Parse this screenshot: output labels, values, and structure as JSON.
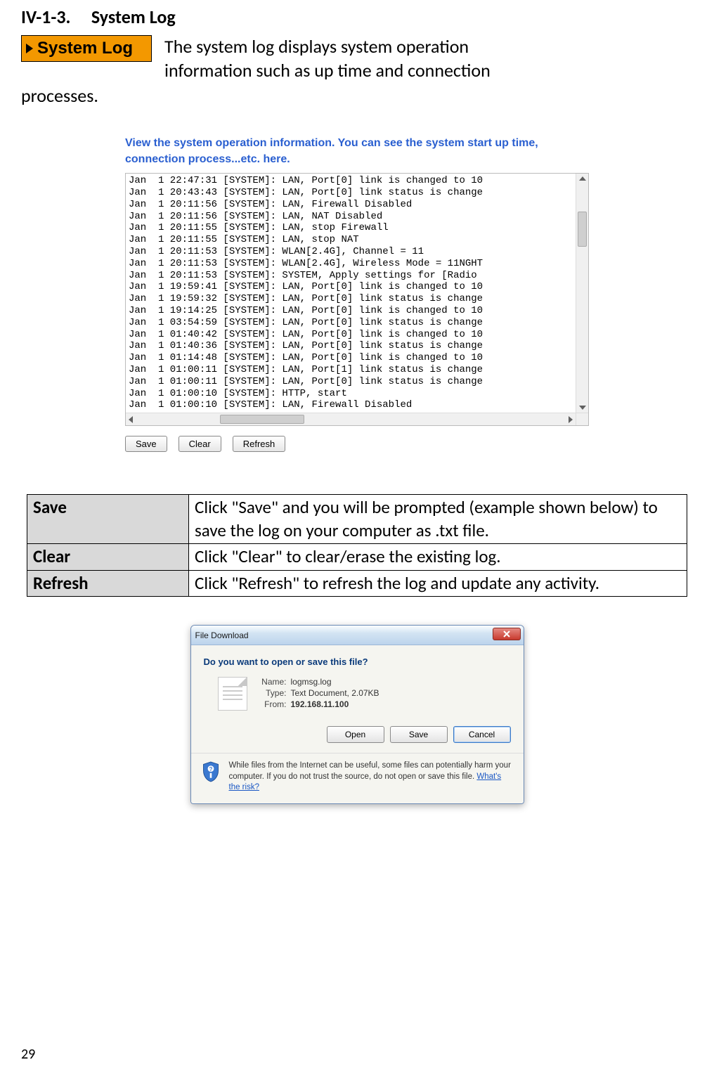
{
  "section": {
    "number": "IV-1-3.",
    "title": "System Log"
  },
  "nav_badge": "System Log",
  "intro_line1": "The system log displays system operation",
  "intro_line2": "information such as up time and connection",
  "intro_line3": "processes.",
  "log_caption": "View the system operation information. You can see the system start up time, connection process...etc. here.",
  "log_lines": [
    "Jan  1 22:47:31 [SYSTEM]: LAN, Port[0] link is changed to 10",
    "Jan  1 20:43:43 [SYSTEM]: LAN, Port[0] link status is change",
    "Jan  1 20:11:56 [SYSTEM]: LAN, Firewall Disabled",
    "Jan  1 20:11:56 [SYSTEM]: LAN, NAT Disabled",
    "Jan  1 20:11:55 [SYSTEM]: LAN, stop Firewall",
    "Jan  1 20:11:55 [SYSTEM]: LAN, stop NAT",
    "Jan  1 20:11:53 [SYSTEM]: WLAN[2.4G], Channel = 11",
    "Jan  1 20:11:53 [SYSTEM]: WLAN[2.4G], Wireless Mode = 11NGHT",
    "Jan  1 20:11:53 [SYSTEM]: SYSTEM, Apply settings for [Radio",
    "Jan  1 19:59:41 [SYSTEM]: LAN, Port[0] link is changed to 10",
    "Jan  1 19:59:32 [SYSTEM]: LAN, Port[0] link status is change",
    "Jan  1 19:14:25 [SYSTEM]: LAN, Port[0] link is changed to 10",
    "Jan  1 03:54:59 [SYSTEM]: LAN, Port[0] link status is change",
    "Jan  1 01:40:42 [SYSTEM]: LAN, Port[0] link is changed to 10",
    "Jan  1 01:40:36 [SYSTEM]: LAN, Port[0] link status is change",
    "Jan  1 01:14:48 [SYSTEM]: LAN, Port[0] link is changed to 10",
    "Jan  1 01:00:11 [SYSTEM]: LAN, Port[1] link status is change",
    "Jan  1 01:00:11 [SYSTEM]: LAN, Port[0] link status is change",
    "Jan  1 01:00:10 [SYSTEM]: HTTP, start",
    "Jan  1 01:00:10 [SYSTEM]: LAN, Firewall Disabled"
  ],
  "buttons": {
    "save": "Save",
    "clear": "Clear",
    "refresh": "Refresh"
  },
  "desc_table": [
    {
      "term": "Save",
      "desc": "Click \"Save\" and you will be prompted (example shown below) to save the log on your computer as .txt file."
    },
    {
      "term": "Clear",
      "desc": "Click \"Clear\" to clear/erase the existing log."
    },
    {
      "term": "Refresh",
      "desc": "Click \"Refresh\" to refresh the log and update any activity."
    }
  ],
  "dialog": {
    "title": "File Download",
    "question": "Do you want to open or save this file?",
    "name_label": "Name:",
    "name_value": "logmsg.log",
    "type_label": "Type:",
    "type_value": "Text Document, 2.07KB",
    "from_label": "From:",
    "from_value": "192.168.11.100",
    "open": "Open",
    "save": "Save",
    "cancel": "Cancel",
    "footer_text": "While files from the Internet can be useful, some files can potentially harm your computer. If you do not trust the source, do not open or save this file. ",
    "footer_link": "What's the risk?"
  },
  "page_number": "29"
}
